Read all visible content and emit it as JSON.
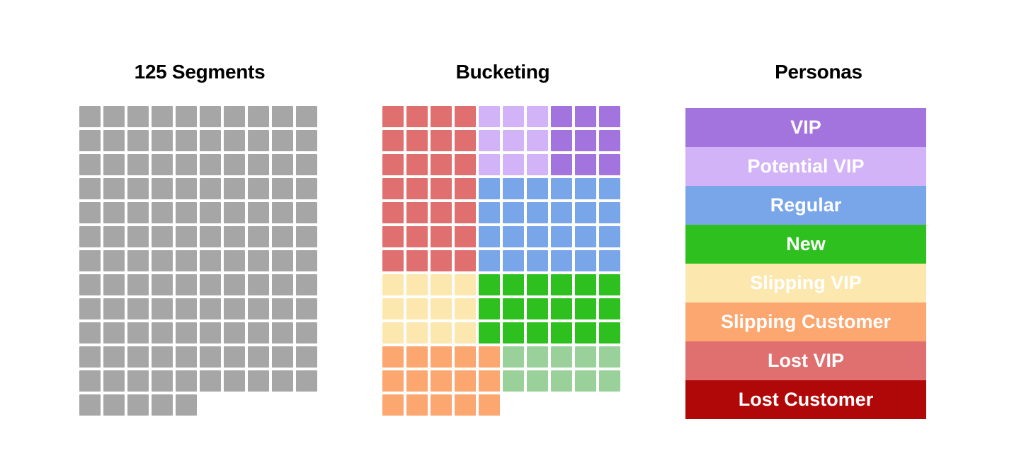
{
  "palette": {
    "grey": "#A6A6A6",
    "vip_purple": "#A474DE",
    "potential_vip_purple": "#D3B3F7",
    "regular_blue": "#79A6E8",
    "new_green": "#2EC01E",
    "slipping_vip_cream": "#FCE7AE",
    "slipping_customer_orange": "#FCA670",
    "lost_vip_red": "#E07070",
    "lost_customer_darkred": "#B00808",
    "light_green": "#9AD19A",
    "background": "#FFFFFF",
    "title_text": "#000000",
    "band_text": "#FFFFFF"
  },
  "panels": {
    "segments": {
      "title": "125 Segments",
      "total_cells": 125,
      "columns": 10,
      "rows": [
        [
          "grey",
          "grey",
          "grey",
          "grey",
          "grey",
          "grey",
          "grey",
          "grey",
          "grey",
          "grey"
        ],
        [
          "grey",
          "grey",
          "grey",
          "grey",
          "grey",
          "grey",
          "grey",
          "grey",
          "grey",
          "grey"
        ],
        [
          "grey",
          "grey",
          "grey",
          "grey",
          "grey",
          "grey",
          "grey",
          "grey",
          "grey",
          "grey"
        ],
        [
          "grey",
          "grey",
          "grey",
          "grey",
          "grey",
          "grey",
          "grey",
          "grey",
          "grey",
          "grey"
        ],
        [
          "grey",
          "grey",
          "grey",
          "grey",
          "grey",
          "grey",
          "grey",
          "grey",
          "grey",
          "grey"
        ],
        [
          "grey",
          "grey",
          "grey",
          "grey",
          "grey",
          "grey",
          "grey",
          "grey",
          "grey",
          "grey"
        ],
        [
          "grey",
          "grey",
          "grey",
          "grey",
          "grey",
          "grey",
          "grey",
          "grey",
          "grey",
          "grey"
        ],
        [
          "grey",
          "grey",
          "grey",
          "grey",
          "grey",
          "grey",
          "grey",
          "grey",
          "grey",
          "grey"
        ],
        [
          "grey",
          "grey",
          "grey",
          "grey",
          "grey",
          "grey",
          "grey",
          "grey",
          "grey",
          "grey"
        ],
        [
          "grey",
          "grey",
          "grey",
          "grey",
          "grey",
          "grey",
          "grey",
          "grey",
          "grey",
          "grey"
        ],
        [
          "grey",
          "grey",
          "grey",
          "grey",
          "grey",
          "grey",
          "grey",
          "grey",
          "grey",
          "grey"
        ],
        [
          "grey",
          "grey",
          "grey",
          "grey",
          "grey",
          "grey",
          "grey",
          "grey",
          "grey",
          "grey"
        ],
        [
          "grey",
          "grey",
          "grey",
          "grey",
          "grey",
          "empty",
          "empty",
          "empty",
          "empty",
          "empty"
        ]
      ]
    },
    "bucketing": {
      "title": "Bucketing",
      "total_cells": 125,
      "columns": 10,
      "rows": [
        [
          "lost_vip_red",
          "lost_vip_red",
          "lost_vip_red",
          "lost_vip_red",
          "potential_vip_purple",
          "potential_vip_purple",
          "potential_vip_purple",
          "vip_purple",
          "vip_purple",
          "vip_purple"
        ],
        [
          "lost_vip_red",
          "lost_vip_red",
          "lost_vip_red",
          "lost_vip_red",
          "potential_vip_purple",
          "potential_vip_purple",
          "potential_vip_purple",
          "vip_purple",
          "vip_purple",
          "vip_purple"
        ],
        [
          "lost_vip_red",
          "lost_vip_red",
          "lost_vip_red",
          "lost_vip_red",
          "potential_vip_purple",
          "potential_vip_purple",
          "potential_vip_purple",
          "vip_purple",
          "vip_purple",
          "vip_purple"
        ],
        [
          "lost_vip_red",
          "lost_vip_red",
          "lost_vip_red",
          "lost_vip_red",
          "regular_blue",
          "regular_blue",
          "regular_blue",
          "regular_blue",
          "regular_blue",
          "regular_blue"
        ],
        [
          "lost_vip_red",
          "lost_vip_red",
          "lost_vip_red",
          "lost_vip_red",
          "regular_blue",
          "regular_blue",
          "regular_blue",
          "regular_blue",
          "regular_blue",
          "regular_blue"
        ],
        [
          "lost_vip_red",
          "lost_vip_red",
          "lost_vip_red",
          "lost_vip_red",
          "regular_blue",
          "regular_blue",
          "regular_blue",
          "regular_blue",
          "regular_blue",
          "regular_blue"
        ],
        [
          "lost_vip_red",
          "lost_vip_red",
          "lost_vip_red",
          "lost_vip_red",
          "regular_blue",
          "regular_blue",
          "regular_blue",
          "regular_blue",
          "regular_blue",
          "regular_blue"
        ],
        [
          "slipping_vip_cream",
          "slipping_vip_cream",
          "slipping_vip_cream",
          "slipping_vip_cream",
          "new_green",
          "new_green",
          "new_green",
          "new_green",
          "new_green",
          "new_green"
        ],
        [
          "slipping_vip_cream",
          "slipping_vip_cream",
          "slipping_vip_cream",
          "slipping_vip_cream",
          "new_green",
          "new_green",
          "new_green",
          "new_green",
          "new_green",
          "new_green"
        ],
        [
          "slipping_vip_cream",
          "slipping_vip_cream",
          "slipping_vip_cream",
          "slipping_vip_cream",
          "new_green",
          "new_green",
          "new_green",
          "new_green",
          "new_green",
          "new_green"
        ],
        [
          "slipping_customer_orange",
          "slipping_customer_orange",
          "slipping_customer_orange",
          "slipping_customer_orange",
          "slipping_customer_orange",
          "light_green",
          "light_green",
          "light_green",
          "light_green",
          "light_green"
        ],
        [
          "slipping_customer_orange",
          "slipping_customer_orange",
          "slipping_customer_orange",
          "slipping_customer_orange",
          "slipping_customer_orange",
          "light_green",
          "light_green",
          "light_green",
          "light_green",
          "light_green"
        ],
        [
          "slipping_customer_orange",
          "slipping_customer_orange",
          "slipping_customer_orange",
          "slipping_customer_orange",
          "slipping_customer_orange",
          "empty",
          "empty",
          "empty",
          "empty",
          "empty"
        ]
      ]
    },
    "personas": {
      "title": "Personas",
      "bands": [
        {
          "label": "VIP",
          "color_key": "vip_purple"
        },
        {
          "label": "Potential VIP",
          "color_key": "potential_vip_purple"
        },
        {
          "label": "Regular",
          "color_key": "regular_blue"
        },
        {
          "label": "New",
          "color_key": "new_green"
        },
        {
          "label": "Slipping VIP",
          "color_key": "slipping_vip_cream"
        },
        {
          "label": "Slipping Customer",
          "color_key": "slipping_customer_orange"
        },
        {
          "label": "Lost VIP",
          "color_key": "lost_vip_red"
        },
        {
          "label": "Lost Customer",
          "color_key": "lost_customer_darkred"
        }
      ]
    }
  }
}
